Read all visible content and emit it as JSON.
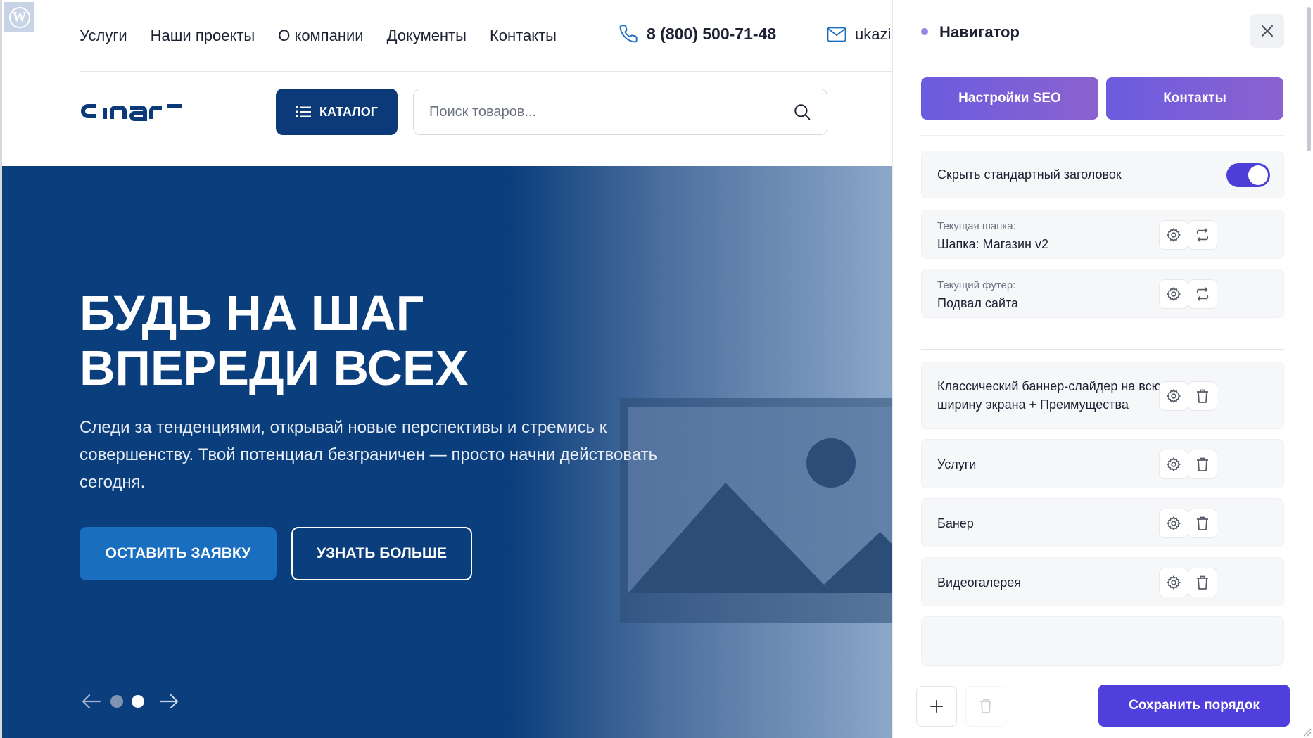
{
  "site": {
    "nav": [
      "Услуги",
      "Наши проекты",
      "О компании",
      "Документы",
      "Контакты"
    ],
    "phone": "8 (800) 500-71-48",
    "email": "ukazi",
    "logo_text": "cinar",
    "catalog_label": "КАТАЛОГ",
    "search_placeholder": "Поиск товаров...",
    "hero": {
      "title_line1": "БУДЬ НА ШАГ",
      "title_line2": "ВПЕРЕДИ ВСЕХ",
      "subtitle": "Следи за тенденциями, открывай новые перспективы и стремись к совершенству. Твой потенциал безграничен — просто начни действовать сегодня.",
      "primary_button": "ОСТАВИТЬ ЗАЯВКУ",
      "secondary_button": "УЗНАТЬ БОЛЬШЕ",
      "slides_total": 2,
      "active_slide": 2
    },
    "colors": {
      "brand_dark": "#0c3a78",
      "hero_bg": "#0b3e7c",
      "button_blue": "#1a6ec0"
    }
  },
  "navigator": {
    "title": "Навигатор",
    "tabs": [
      "Настройки SEO",
      "Контакты"
    ],
    "hide_header_label": "Скрыть стандартный заголовок",
    "hide_header_enabled": true,
    "current_header": {
      "caption": "Текущая шапка:",
      "value": "Шапка: Магазин v2"
    },
    "current_footer": {
      "caption": "Текущий футер:",
      "value": "Подвал сайта"
    },
    "blocks": [
      {
        "label": "Классический баннер-слайдер на всю ширину экрана + Преимущества"
      },
      {
        "label": "Услуги"
      },
      {
        "label": "Банер"
      },
      {
        "label": "Видеогалерея"
      }
    ],
    "save_label": "Сохранить порядок",
    "colors": {
      "accent": "#4f3fdc",
      "tab_gradient_start": "#6b5cdf",
      "tab_gradient_end": "#8b62cf"
    }
  }
}
